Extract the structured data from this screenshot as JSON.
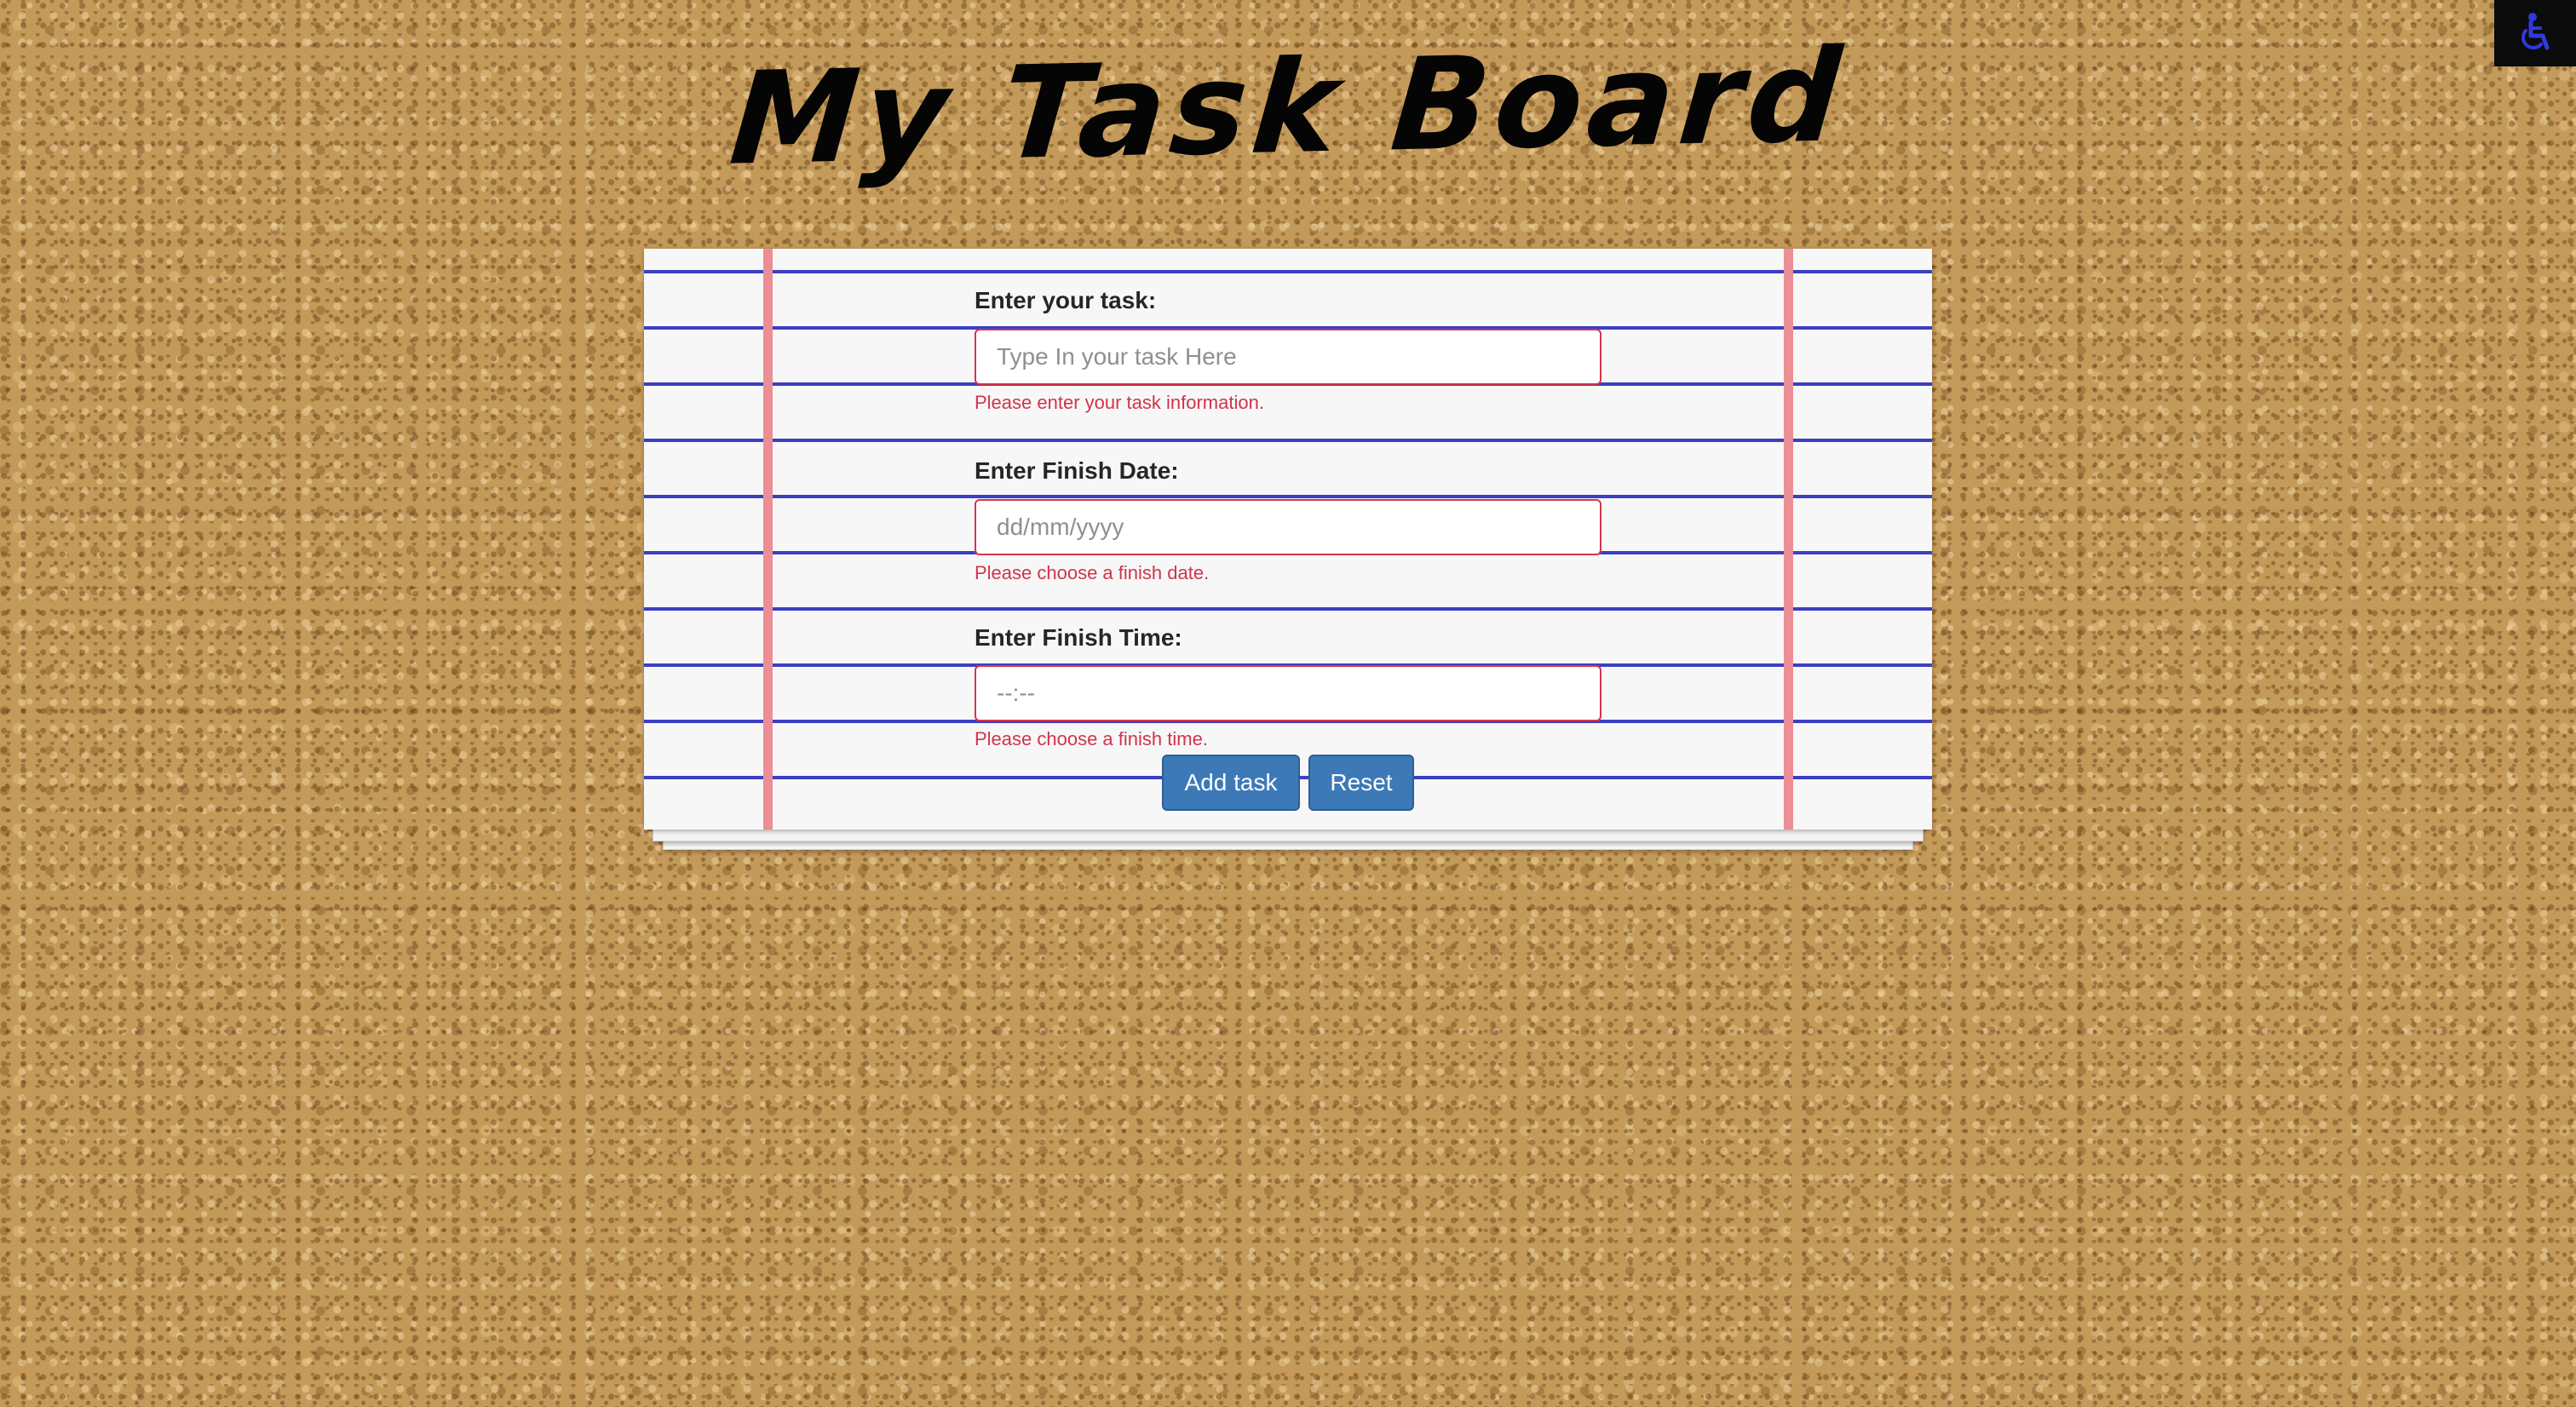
{
  "header": {
    "title": "My Task Board"
  },
  "accessibility": {
    "icon": "wheelchair-icon",
    "icon_color": "#2f3bd8"
  },
  "form": {
    "task": {
      "label": "Enter your task:",
      "placeholder": "Type In your task Here",
      "error": "Please enter your task information."
    },
    "date": {
      "label": "Enter Finish Date:",
      "placeholder": "dd/mm/yyyy",
      "error": "Please choose a finish date."
    },
    "time": {
      "label": "Enter Finish Time:",
      "placeholder": "--:--",
      "error": "Please choose a finish time."
    },
    "add_label": "Add task",
    "reset_label": "Reset"
  },
  "colors": {
    "error": "#d1344a",
    "button": "#3d79b7",
    "ruled_line": "#3b3fc2",
    "margin_line": "#ec8e95"
  }
}
